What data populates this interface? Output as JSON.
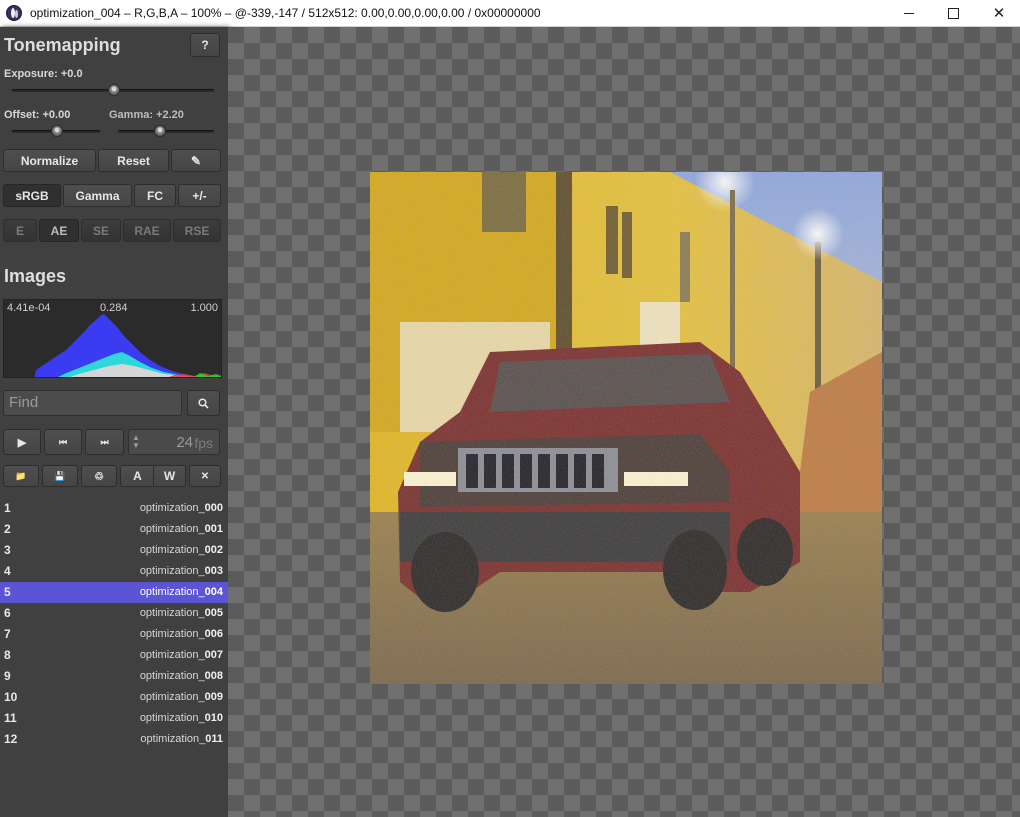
{
  "window": {
    "title": "optimization_004 – R,G,B,A – 100% – @-339,-147 / 512x512: 0.00,0.00,0.00,0.00 / 0x00000000",
    "min_label": "",
    "max_label": "",
    "close_label": "✕"
  },
  "tonemapping": {
    "heading": "Tonemapping",
    "help_label": "?",
    "exposure_label": "Exposure: +0.0",
    "exposure_value": 0.0,
    "offset_label": "Offset: +0.00",
    "offset_value": 0.0,
    "gamma_label": "Gamma: +2.20",
    "gamma_value": 2.2,
    "normalize_label": "Normalize",
    "reset_label": "Reset",
    "edit_icon": "pencil-icon",
    "edit_label": "✎",
    "srgb_label": "sRGB",
    "gamma_btn_label": "Gamma",
    "fc_label": "FC",
    "plusminus_label": "+/-",
    "metrics": [
      {
        "label": "E",
        "active": false
      },
      {
        "label": "AE",
        "active": true
      },
      {
        "label": "SE",
        "active": false
      },
      {
        "label": "RAE",
        "active": false
      },
      {
        "label": "RSE",
        "active": false
      }
    ]
  },
  "images": {
    "heading": "Images",
    "histogram": {
      "min_label": "4.41e-04",
      "mid_label": "0.284",
      "max_label": "1.000"
    },
    "find_placeholder": "Find",
    "search_icon_label": "🔍",
    "playback": {
      "play_label": "▶",
      "prev_label": "⏮",
      "next_label": "⏭",
      "fps_value": "24",
      "fps_unit": "fps"
    },
    "actions": [
      {
        "name": "open-folder-button",
        "label": "📁"
      },
      {
        "name": "save-button",
        "label": "💾"
      },
      {
        "name": "reload-button",
        "label": "♲"
      },
      {
        "name": "reload-all-button",
        "label": "A"
      },
      {
        "name": "watch-button",
        "label": "W"
      },
      {
        "name": "close-image-button",
        "label": "✕"
      }
    ],
    "list": [
      {
        "num": "1",
        "prefix": "optimization_",
        "suffix": "000",
        "selected": false
      },
      {
        "num": "2",
        "prefix": "optimization_",
        "suffix": "001",
        "selected": false
      },
      {
        "num": "3",
        "prefix": "optimization_",
        "suffix": "002",
        "selected": false
      },
      {
        "num": "4",
        "prefix": "optimization_",
        "suffix": "003",
        "selected": false
      },
      {
        "num": "5",
        "prefix": "optimization_",
        "suffix": "004",
        "selected": true
      },
      {
        "num": "6",
        "prefix": "optimization_",
        "suffix": "005",
        "selected": false
      },
      {
        "num": "7",
        "prefix": "optimization_",
        "suffix": "006",
        "selected": false
      },
      {
        "num": "8",
        "prefix": "optimization_",
        "suffix": "007",
        "selected": false
      },
      {
        "num": "9",
        "prefix": "optimization_",
        "suffix": "008",
        "selected": false
      },
      {
        "num": "10",
        "prefix": "optimization_",
        "suffix": "009",
        "selected": false
      },
      {
        "num": "11",
        "prefix": "optimization_",
        "suffix": "010",
        "selected": false
      },
      {
        "num": "12",
        "prefix": "optimization_",
        "suffix": "011",
        "selected": false
      }
    ]
  },
  "colors": {
    "selection": "#5b55d6",
    "sidebar": "#404040",
    "histogram_blue": "#3a3aff",
    "histogram_cyan": "#2fe0e0"
  }
}
